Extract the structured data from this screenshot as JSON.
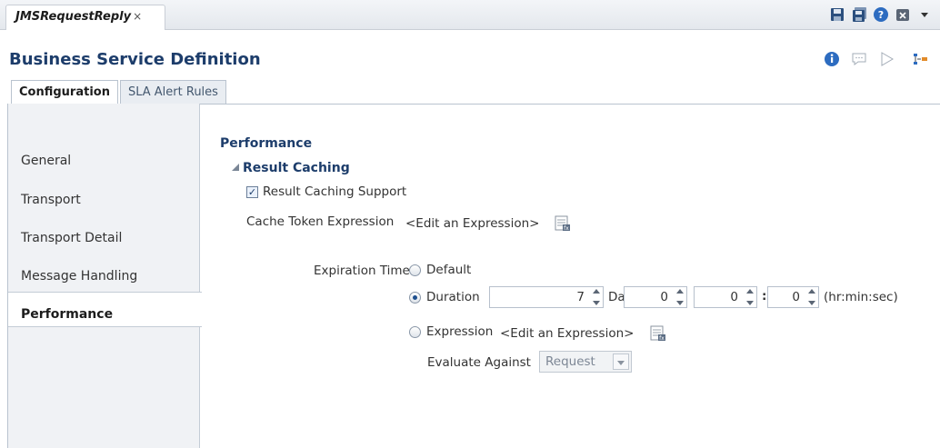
{
  "editor_tab": {
    "label": "JMSRequestReply",
    "close": "×"
  },
  "header": {
    "title": "Business Service Definition"
  },
  "subtabs": [
    {
      "label": "Configuration",
      "active": true
    },
    {
      "label": "SLA Alert Rules",
      "active": false
    }
  ],
  "sidebar": {
    "items": [
      {
        "label": "General",
        "active": false
      },
      {
        "label": "Transport",
        "active": false
      },
      {
        "label": "Transport Detail",
        "active": false
      },
      {
        "label": "Message Handling",
        "active": false
      },
      {
        "label": "Performance",
        "active": true
      }
    ]
  },
  "performance": {
    "section_title": "Performance",
    "subsection_title": "Result Caching",
    "result_caching_support": {
      "label": "Result Caching Support",
      "checked": true
    },
    "cache_token": {
      "label": "Cache Token Expression",
      "value": "<Edit an Expression>"
    },
    "expiration_time": {
      "label": "Expiration Time",
      "options": {
        "default": {
          "label": "Default",
          "selected": false
        },
        "duration": {
          "label": "Duration",
          "selected": true
        },
        "expression": {
          "label": "Expression",
          "selected": false
        }
      },
      "duration": {
        "days": "7",
        "days_label": "Days",
        "hours": "0",
        "minutes": "0",
        "seconds": "0",
        "sep": ":",
        "format_label": "(hr:min:sec)"
      },
      "expression_value": "<Edit an Expression>"
    },
    "evaluate_against": {
      "label": "Evaluate Against",
      "value": "Request"
    }
  },
  "colors": {
    "title": "#1d3d6b",
    "accent": "#1e4f8e"
  }
}
